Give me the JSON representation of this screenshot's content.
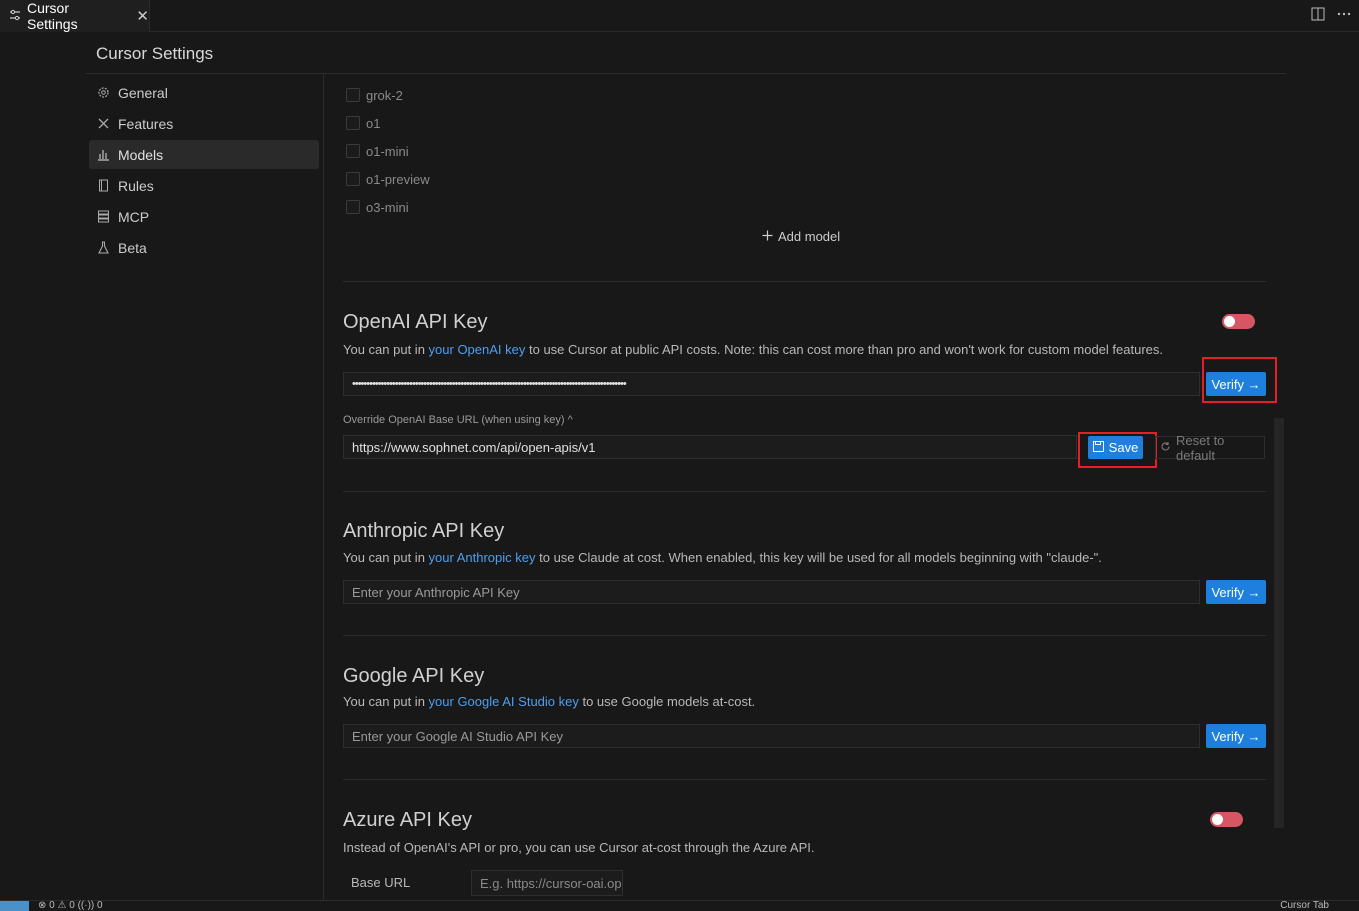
{
  "tab": {
    "title": "Cursor Settings",
    "close": "✕"
  },
  "settings_title": "Cursor Settings",
  "sidebar": {
    "items": [
      {
        "label": "General",
        "icon": "gear-icon"
      },
      {
        "label": "Features",
        "icon": "tools-icon"
      },
      {
        "label": "Models",
        "icon": "chart-icon",
        "active": true
      },
      {
        "label": "Rules",
        "icon": "book-icon"
      },
      {
        "label": "MCP",
        "icon": "server-icon"
      },
      {
        "label": "Beta",
        "icon": "flask-icon"
      }
    ]
  },
  "models": [
    "grok-2",
    "o1",
    "o1-mini",
    "o1-preview",
    "o3-mini"
  ],
  "add_model": "Add model",
  "openai": {
    "title": "OpenAI API Key",
    "desc_prefix": "You can put in ",
    "desc_link": "your OpenAI key",
    "desc_suffix": " to use Cursor at public API costs. Note: this can cost more than pro and won't work for custom model features.",
    "key_value": "••••••••••••••••••••••••••••••••••••••••••••••••••••••••••••••••••••••••••••••••••••••••••••••••",
    "verify": "Verify →",
    "override_label": "Override OpenAI Base URL (when using key) ^",
    "base_url": "https://www.sophnet.com/api/open-apis/v1",
    "save": "Save",
    "reset": "Reset to default"
  },
  "anthropic": {
    "title": "Anthropic API Key",
    "desc_prefix": "You can put in ",
    "desc_link": "your Anthropic key",
    "desc_suffix": " to use Claude at cost. When enabled, this key will be used for all models beginning with \"claude-\".",
    "placeholder": "Enter your Anthropic API Key",
    "verify": "Verify →"
  },
  "google": {
    "title": "Google API Key",
    "desc_prefix": "You can put in ",
    "desc_link": "your Google AI Studio key",
    "desc_suffix": " to use Google models at-cost.",
    "placeholder": "Enter your Google AI Studio API Key",
    "verify": "Verify →"
  },
  "azure": {
    "title": "Azure API Key",
    "desc": "Instead of OpenAI's API or pro, you can use Cursor at-cost through the Azure API.",
    "base_url_label": "Base URL",
    "base_url_placeholder": "E.g. https://cursor-oai.op"
  },
  "statusbar": {
    "left": "⊗ 0 ⚠ 0   ((·)) 0",
    "right": "Cursor Tab"
  },
  "colors": {
    "accent": "#1f7fdd",
    "toggle_off": "#d65663",
    "link": "#4d9ff0",
    "highlight": "#e3202a"
  }
}
